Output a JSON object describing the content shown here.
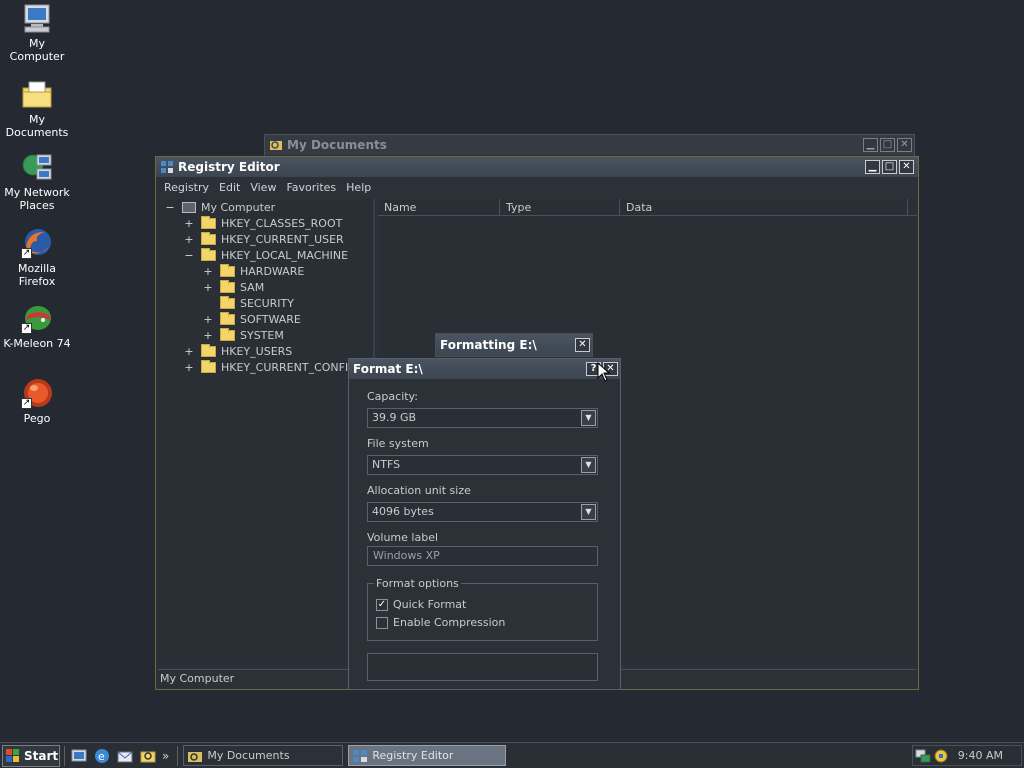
{
  "desktop": {
    "icons": [
      {
        "label": "My Computer",
        "icon": "my-computer-icon"
      },
      {
        "label": "My Documents",
        "icon": "my-documents-icon"
      },
      {
        "label": "My Network Places",
        "icon": "network-places-icon"
      },
      {
        "label": "Mozilla Firefox",
        "icon": "firefox-icon"
      },
      {
        "label": "K-Meleon 74",
        "icon": "k-meleon-icon"
      },
      {
        "label": "Pego",
        "icon": "pego-icon"
      }
    ]
  },
  "my_documents_window": {
    "title": "My Documents"
  },
  "registry_editor": {
    "title": "Registry Editor",
    "menu": [
      "Registry",
      "Edit",
      "View",
      "Favorites",
      "Help"
    ],
    "tree": {
      "root": "My Computer",
      "items": [
        {
          "label": "HKEY_CLASSES_ROOT",
          "expander": "+"
        },
        {
          "label": "HKEY_CURRENT_USER",
          "expander": "+"
        },
        {
          "label": "HKEY_LOCAL_MACHINE",
          "expander": "−"
        },
        {
          "label": "HARDWARE",
          "expander": "+"
        },
        {
          "label": "SAM",
          "expander": "+"
        },
        {
          "label": "SECURITY",
          "expander": ""
        },
        {
          "label": "SOFTWARE",
          "expander": "+"
        },
        {
          "label": "SYSTEM",
          "expander": "+"
        },
        {
          "label": "HKEY_USERS",
          "expander": "+"
        },
        {
          "label": "HKEY_CURRENT_CONFIG",
          "expander": "+"
        }
      ]
    },
    "columns": [
      "Name",
      "Type",
      "Data"
    ],
    "status": "My Computer"
  },
  "formatting_window": {
    "title": "Formatting E:\\"
  },
  "format_dialog": {
    "title": "Format E:\\",
    "capacity_label": "Capacity:",
    "capacity_value": "39.9 GB",
    "filesystem_label": "File system",
    "filesystem_value": "NTFS",
    "allocation_label": "Allocation unit size",
    "allocation_value": "4096 bytes",
    "volume_label": "Volume label",
    "volume_value": "Windows XP",
    "options_legend": "Format options",
    "quick_format_label": "Quick Format",
    "quick_format_checked": true,
    "compression_label": "Enable Compression",
    "compression_checked": false,
    "progress": 0
  },
  "taskbar": {
    "start_label": "Start",
    "more_glyph": "»",
    "tasks": [
      {
        "label": "My Documents",
        "active": false
      },
      {
        "label": "Registry Editor",
        "active": true
      }
    ],
    "clock": "9:40 AM"
  }
}
